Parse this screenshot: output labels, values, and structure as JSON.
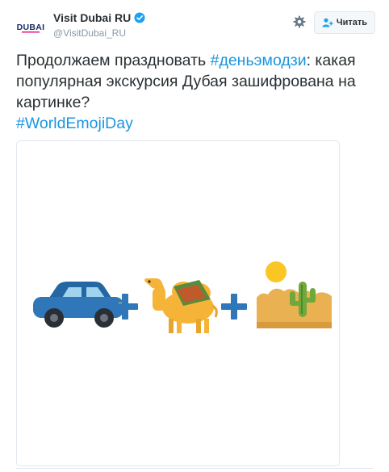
{
  "account": {
    "name": "Visit Dubai RU",
    "handle": "@VisitDubai_RU",
    "avatar_text": "DUBAI",
    "verified": true
  },
  "actions": {
    "settings_icon": "gear-icon",
    "follow_label": "Читать",
    "follow_icon": "add-user-icon"
  },
  "tweet": {
    "text_before": "Продолжаем праздновать ",
    "hashtag_1": "#деньэмодзи",
    "text_middle": ": какая популярная экскурсия Дубая зашифрована на картинке?",
    "hashtag_2": "#WorldEmojiDay"
  },
  "media": {
    "emojis": [
      "car-emoji",
      "plus-sign",
      "camel-emoji",
      "plus-sign",
      "desert-emoji"
    ]
  },
  "colors": {
    "link": "#1b95e0",
    "text": "#292f33",
    "muted": "#8899a6",
    "verified": "#1da1f2"
  }
}
